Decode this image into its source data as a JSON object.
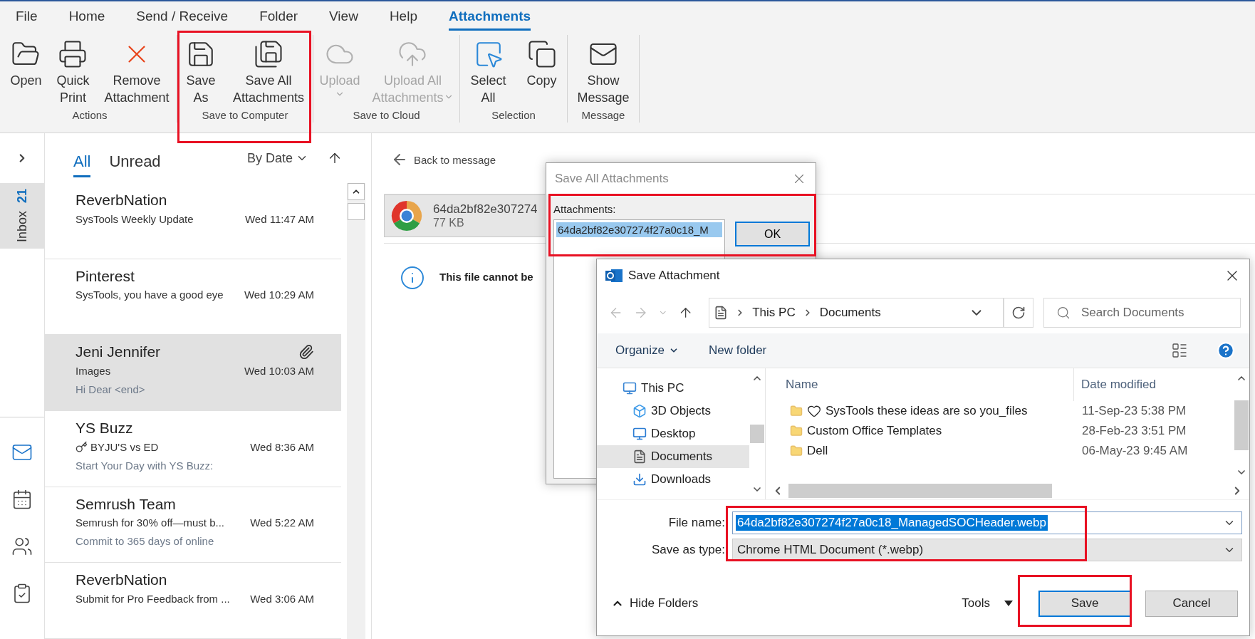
{
  "menu_tabs": [
    {
      "label": "File",
      "selected": false
    },
    {
      "label": "Home",
      "selected": false
    },
    {
      "label": "Send / Receive",
      "selected": false
    },
    {
      "label": "Folder",
      "selected": false
    },
    {
      "label": "View",
      "selected": false
    },
    {
      "label": "Help",
      "selected": false
    },
    {
      "label": "Attachments",
      "selected": true
    }
  ],
  "ribbon_groups": [
    {
      "label": "Actions",
      "buttons": [
        {
          "lines": [
            "Open"
          ],
          "disabled": false,
          "dropdown": false
        },
        {
          "lines": [
            "Quick",
            "Print"
          ],
          "disabled": false,
          "dropdown": false
        },
        {
          "lines": [
            "Remove",
            "Attachment"
          ],
          "disabled": false,
          "dropdown": false
        }
      ]
    },
    {
      "label": "Save to Computer",
      "buttons": [
        {
          "lines": [
            "Save",
            "As"
          ],
          "disabled": false,
          "dropdown": false
        },
        {
          "lines": [
            "Save All",
            "Attachments"
          ],
          "disabled": false,
          "dropdown": false
        }
      ]
    },
    {
      "label": "Save to Cloud",
      "buttons": [
        {
          "lines": [
            "Upload"
          ],
          "disabled": true,
          "dropdown": true
        },
        {
          "lines": [
            "Upload All",
            "Attachments"
          ],
          "disabled": true,
          "dropdown": true
        }
      ]
    },
    {
      "label": "Selection",
      "buttons": [
        {
          "lines": [
            "Select",
            "All"
          ],
          "disabled": false,
          "dropdown": false
        },
        {
          "lines": [
            "Copy"
          ],
          "disabled": false,
          "dropdown": false
        }
      ]
    },
    {
      "label": "Message",
      "buttons": [
        {
          "lines": [
            "Show",
            "Message"
          ],
          "disabled": false,
          "dropdown": false
        }
      ]
    }
  ],
  "nav": {
    "folder": "Inbox",
    "count": "21",
    "modules": [
      {
        "selected": true
      },
      {
        "selected": false
      },
      {
        "selected": false
      },
      {
        "selected": false
      }
    ]
  },
  "mail_list": {
    "tabs": [
      {
        "label": "All",
        "selected": true
      },
      {
        "label": "Unread",
        "selected": false
      }
    ],
    "sort": "By Date",
    "messages": [
      {
        "sender": "ReverbNation",
        "subject": "SysTools Weekly Update",
        "date": "Wed 11:47 AM",
        "selected": false,
        "attachment": false,
        "tagged": false
      },
      {
        "sender": "Pinterest",
        "subject": "SysTools, you have a good eye",
        "date": "Wed 10:29 AM",
        "selected": false,
        "attachment": false,
        "tagged": false
      },
      {
        "sender": "Jeni Jennifer",
        "subject": "Images",
        "date": "Wed 10:03 AM",
        "preview": "Hi Dear <end>",
        "selected": true,
        "attachment": true,
        "tagged": false
      },
      {
        "sender": "YS Buzz",
        "subject": "BYJU'S vs ED",
        "date": "Wed 8:36 AM",
        "preview": "Start Your Day with YS Buzz:",
        "selected": false,
        "attachment": false,
        "tagged": true
      },
      {
        "sender": "Semrush Team",
        "subject": "Semrush for 30% off—must b...",
        "date": "Wed 5:22 AM",
        "preview": "Commit to 365 days of online",
        "selected": false,
        "attachment": false,
        "tagged": false
      },
      {
        "sender": "ReverbNation",
        "subject": "Submit for Pro Feedback from ...",
        "date": "Wed 3:06 AM",
        "selected": false,
        "attachment": false,
        "tagged": false
      }
    ]
  },
  "reading_pane": {
    "back": "Back to message",
    "attachment": {
      "name": "64da2bf82e307274",
      "size": "77 KB"
    },
    "notice": "This file cannot be"
  },
  "save_all_dialog": {
    "title": "Save All Attachments",
    "label": "Attachments:",
    "items": [
      {
        "name": "64da2bf82e307274f27a0c18_M",
        "selected": true
      }
    ],
    "ok": "OK"
  },
  "save_dialog": {
    "title": "Save Attachment",
    "path": [
      "This PC",
      "Documents"
    ],
    "search_placeholder": "Search Documents",
    "organize": "Organize",
    "new_folder": "New folder",
    "tree": [
      {
        "label": "This PC",
        "selected": false,
        "children": [
          {
            "label": "3D Objects",
            "selected": false
          },
          {
            "label": "Desktop",
            "selected": false
          },
          {
            "label": "Documents",
            "selected": true
          },
          {
            "label": "Downloads",
            "selected": false
          }
        ]
      }
    ],
    "columns": [
      "Name",
      "Date modified"
    ],
    "files": [
      {
        "name": "SysTools these ideas are so you_files",
        "date": "11-Sep-23 5:38 PM",
        "heart": true
      },
      {
        "name": "Custom Office Templates",
        "date": "28-Feb-23 3:51 PM",
        "heart": false
      },
      {
        "name": "Dell",
        "date": "06-May-23 9:45 AM",
        "heart": false
      }
    ],
    "file_name_label": "File name:",
    "file_name": "64da2bf82e307274f27a0c18_ManagedSOCHeader.webp",
    "type_label": "Save as type:",
    "type": "Chrome HTML Document (*.webp)",
    "hide_folders": "Hide Folders",
    "tools": "Tools",
    "save": "Save",
    "cancel": "Cancel"
  }
}
